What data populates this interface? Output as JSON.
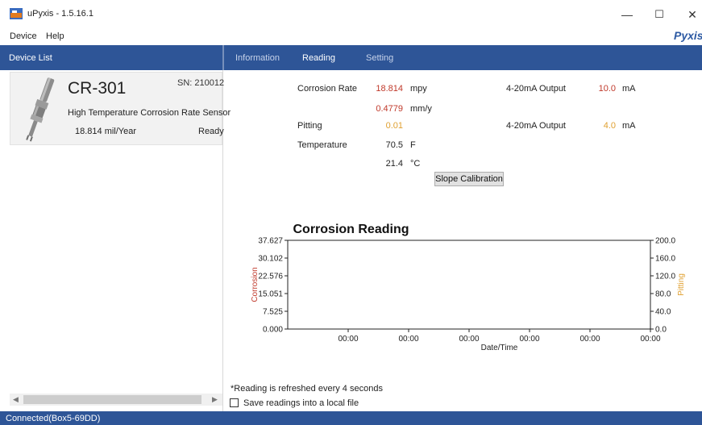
{
  "window": {
    "title": "uPyxis - 1.5.16.1",
    "minimize_glyph": "—",
    "maximize_glyph": "☐",
    "close_glyph": "✕",
    "icon": "app-icon"
  },
  "menu": {
    "device": "Device",
    "help": "Help"
  },
  "brand": {
    "logo_text": "Pyxis",
    "color": "#2d5aa3"
  },
  "colors": {
    "header_blue": "#2e5597",
    "red_value": "#c0392b",
    "gold_value": "#e0a030",
    "pitting_axis": "#e0a030",
    "corrosion_axis": "#c0392b"
  },
  "left_panel": {
    "header": "Device List",
    "device": {
      "model": "CR-301",
      "serial": "SN: 210012",
      "description": "High Temperature Corrosion Rate Sensor",
      "value": "18.814  mil/Year",
      "status": "Ready"
    },
    "scrollbar": {
      "left_glyph": "◀",
      "right_glyph": "▶"
    }
  },
  "tabs": {
    "information": "Information",
    "reading": "Reading",
    "setting": "Setting"
  },
  "readings": {
    "corrosion_rate_label": "Corrosion Rate",
    "corrosion_rate_value": "18.814",
    "corrosion_rate_unit": "mpy",
    "corrosion_rate_value_metric": "0.4779",
    "corrosion_rate_unit_metric": "mm/y",
    "pitting_label": "Pitting",
    "pitting_value": "0.01",
    "temperature_label": "Temperature",
    "temperature_f_value": "70.5",
    "temperature_f_unit": "F",
    "temperature_c_value": "21.4",
    "temperature_c_unit": "°C",
    "output1_label": "4-20mA Output",
    "output1_value": "10.0",
    "output1_unit": "mA",
    "output2_label": "4-20mA Output",
    "output2_value": "4.0",
    "output2_unit": "mA",
    "slope_button": "Slope Calibration"
  },
  "chart_data": {
    "type": "line",
    "title": "Corrosion Reading",
    "xlabel": "Date/Time",
    "ylabel_left": "Corrosion",
    "ylabel_right": "Pitting",
    "x_tick_labels": [
      "00:00",
      "00:00",
      "00:00",
      "00:00",
      "00:00",
      "00:00"
    ],
    "y_left_ticks": [
      "0.000",
      "7.525",
      "15.051",
      "22.576",
      "30.102",
      "37.627"
    ],
    "y_right_ticks": [
      "0.0",
      "40.0",
      "80.0",
      "120.0",
      "160.0",
      "200.0"
    ],
    "ylim_left": [
      0,
      37.627
    ],
    "ylim_right": [
      0,
      200
    ],
    "grid": true,
    "series": []
  },
  "footer": {
    "refresh_note": "*Reading is refreshed every 4 seconds",
    "save_label": "Save readings into a local file",
    "save_checked": false
  },
  "status_bar": {
    "text": "Connected(Box5-69DD)"
  }
}
